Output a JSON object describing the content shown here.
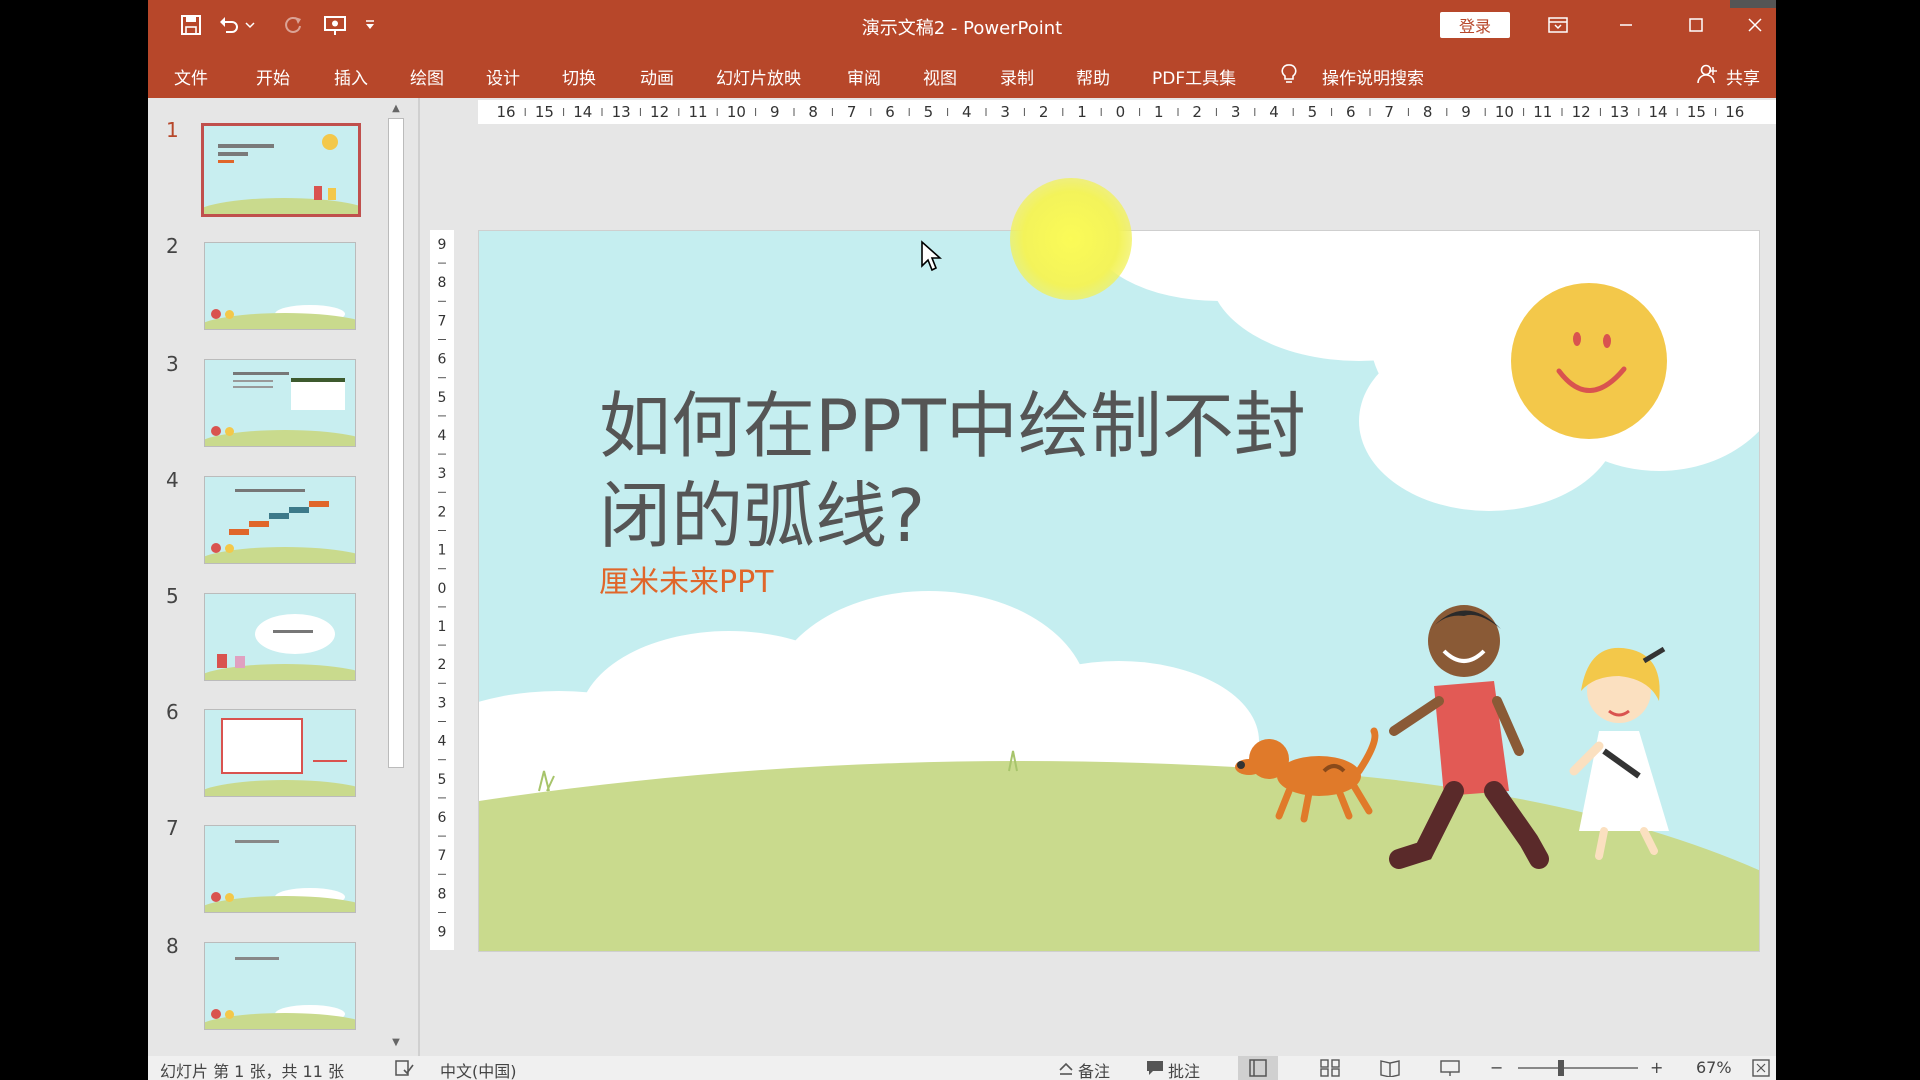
{
  "window": {
    "title": "演示文稿2  -  PowerPoint",
    "signin_label": "登录"
  },
  "ribbon": {
    "tabs": [
      "文件",
      "开始",
      "插入",
      "绘图",
      "设计",
      "切换",
      "动画",
      "幻灯片放映",
      "审阅",
      "视图",
      "录制",
      "帮助",
      "PDF工具集"
    ],
    "search_label": "操作说明搜索",
    "share_label": "共享"
  },
  "thumbnails": [
    {
      "number": "1",
      "active": true
    },
    {
      "number": "2"
    },
    {
      "number": "3"
    },
    {
      "number": "4"
    },
    {
      "number": "5"
    },
    {
      "number": "6"
    },
    {
      "number": "7"
    },
    {
      "number": "8"
    }
  ],
  "ruler": {
    "horizontal": [
      "16",
      "15",
      "14",
      "13",
      "12",
      "11",
      "10",
      "9",
      "8",
      "7",
      "6",
      "5",
      "4",
      "3",
      "2",
      "1",
      "0",
      "1",
      "2",
      "3",
      "4",
      "5",
      "6",
      "7",
      "8",
      "9",
      "10",
      "11",
      "12",
      "13",
      "14",
      "15",
      "16"
    ],
    "vertical": [
      "9",
      "8",
      "7",
      "6",
      "5",
      "4",
      "3",
      "2",
      "1",
      "0",
      "1",
      "2",
      "3",
      "4",
      "5",
      "6",
      "7",
      "8",
      "9"
    ]
  },
  "slide": {
    "title_line1": "如何在PPT中绘制不封",
    "title_line2": "闭的弧线?",
    "subtitle": "厘米未来PPT"
  },
  "statusbar": {
    "slide_info": "幻灯片 第 1 张，共 11 张",
    "language": "中文(中国)",
    "notes_label": "备注",
    "comments_label": "批注",
    "zoom_minus": "−",
    "zoom_plus": "+",
    "zoom_level": "67%"
  },
  "colors": {
    "accent": "#b7472a",
    "slide_bg": "#c5eef0",
    "subtitle": "#e0662a"
  }
}
